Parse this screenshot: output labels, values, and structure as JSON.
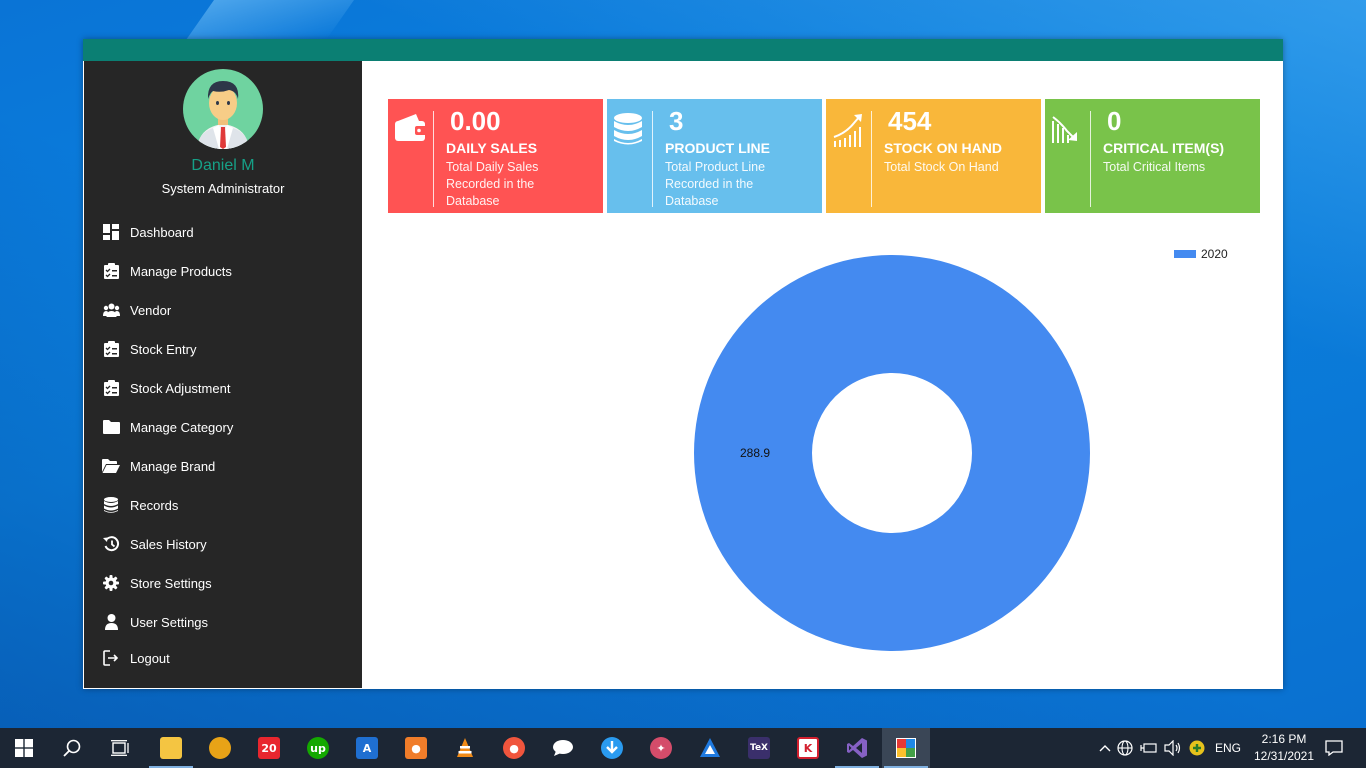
{
  "user": {
    "name": "Daniel M",
    "role": "System Administrator"
  },
  "menu": [
    {
      "label": "Dashboard",
      "icon": "dashboard-icon"
    },
    {
      "label": "Manage Products",
      "icon": "clipboard-icon"
    },
    {
      "label": "Vendor",
      "icon": "users-icon"
    },
    {
      "label": "Stock Entry",
      "icon": "clipboard-icon"
    },
    {
      "label": "Stock Adjustment",
      "icon": "clipboard-icon"
    },
    {
      "label": "Manage Category",
      "icon": "folder-icon"
    },
    {
      "label": "Manage Brand",
      "icon": "folder-open-icon"
    },
    {
      "label": "Records",
      "icon": "database-icon"
    },
    {
      "label": "Sales History",
      "icon": "history-icon"
    },
    {
      "label": "Store Settings",
      "icon": "gear-icon"
    },
    {
      "label": "User Settings",
      "icon": "user-icon"
    },
    {
      "label": "Logout",
      "icon": "logout-icon"
    }
  ],
  "cards": [
    {
      "value": "0.00",
      "title": "DAILY SALES",
      "desc": "Total Daily Sales Recorded  in the Database",
      "color": "#ff5353",
      "icon": "wallet-icon"
    },
    {
      "value": "3",
      "title": "PRODUCT LINE",
      "desc": "Total Product Line Recorded  in the Database",
      "color": "#67bfed",
      "icon": "database-icon"
    },
    {
      "value": "454",
      "title": "STOCK ON HAND",
      "desc": "Total Stock On Hand",
      "color": "#f9b73a",
      "icon": "trend-up-icon"
    },
    {
      "value": "0",
      "title": "CRITICAL ITEM(S)",
      "desc": "Total Critical Items",
      "color": "#79c34a",
      "icon": "trend-down-icon"
    }
  ],
  "chart_data": {
    "type": "pie",
    "donut": true,
    "series": [
      {
        "name": "2020",
        "values": [
          288.9
        ]
      }
    ],
    "labels": [
      "288.9"
    ],
    "legend": "top-right",
    "color": "#448af0"
  },
  "taskbar": {
    "apps": [
      "file-explorer",
      "chrome-canary",
      "20-app",
      "upwork",
      "app-a",
      "app-orange",
      "vlc",
      "app-red",
      "messages",
      "download",
      "paint",
      "app-triangle",
      "tex",
      "app-red2",
      "visual-studio",
      "active-app"
    ],
    "language": "ENG",
    "time": "2:16 PM",
    "date": "12/31/2021"
  }
}
